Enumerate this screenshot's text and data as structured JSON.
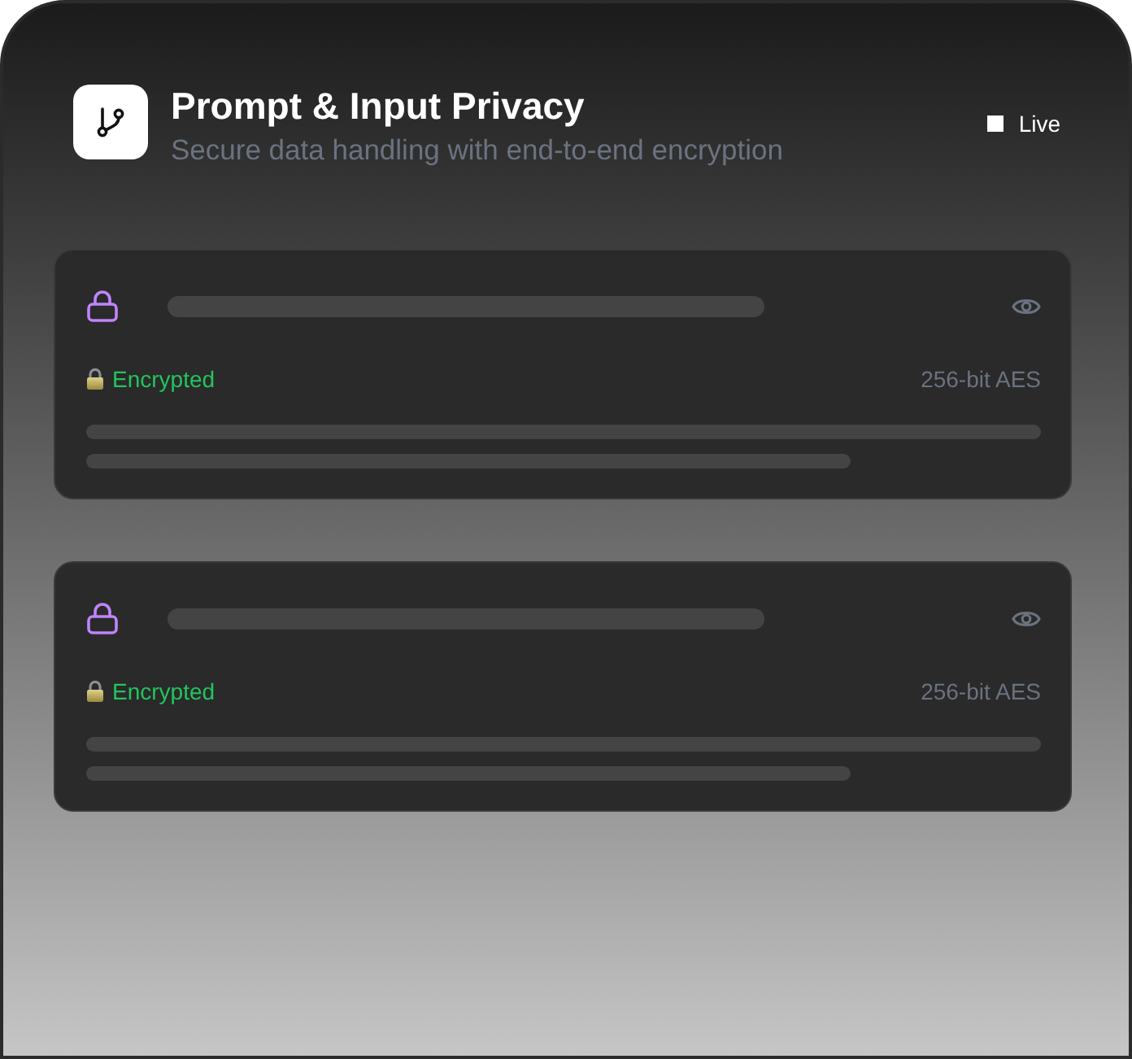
{
  "header": {
    "title": "Prompt & Input Privacy",
    "subtitle": "Secure data handling with end-to-end encryption",
    "status": {
      "label": "Live"
    }
  },
  "cards": [
    {
      "status": "Encrypted",
      "encryption": "256-bit AES"
    },
    {
      "status": "Encrypted",
      "encryption": "256-bit AES"
    }
  ]
}
